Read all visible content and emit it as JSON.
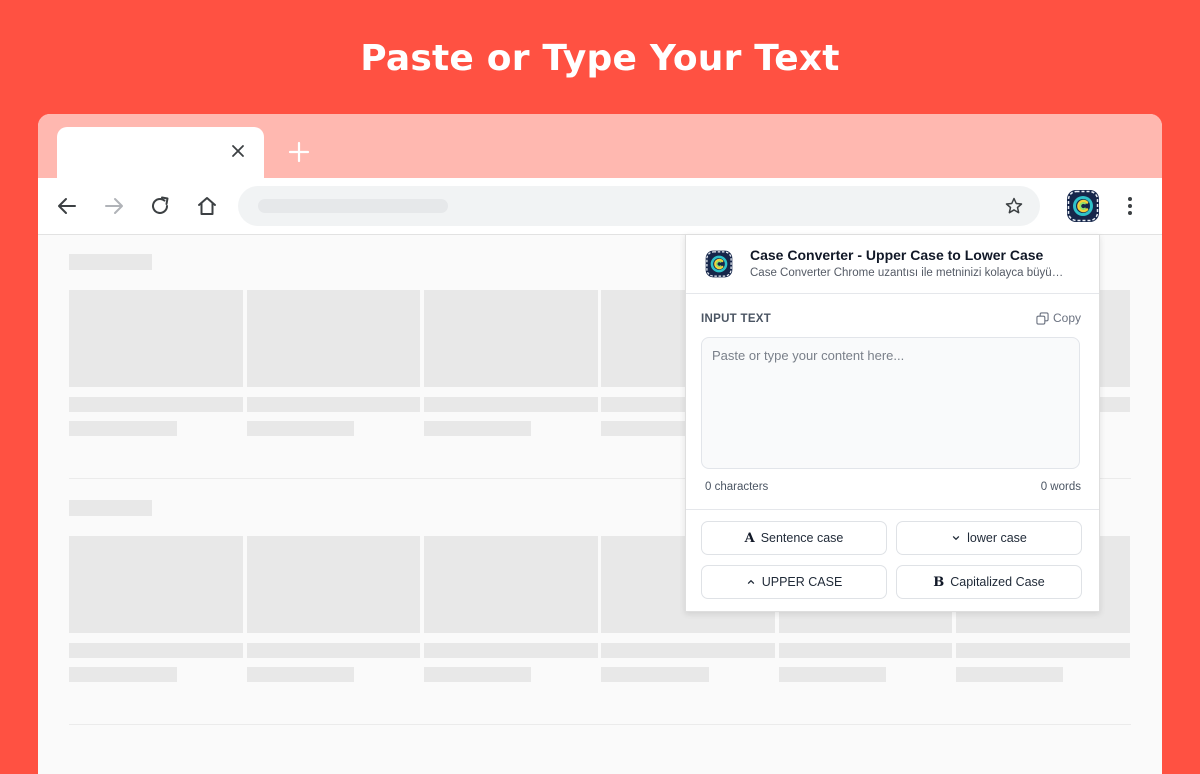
{
  "headline": "Paste or Type Your Text",
  "popup": {
    "title": "Case Converter - Upper Case to Lower Case",
    "subtitle": "Case Converter Chrome uzantısı ile metninizi kolayca büyü…",
    "input_label": "INPUT TEXT",
    "copy_label": "Copy",
    "textarea_placeholder": "Paste or type your content here...",
    "textarea_value": "",
    "char_count": "0 characters",
    "word_count": "0 words",
    "buttons": [
      {
        "label": "Sentence case",
        "icon": "A"
      },
      {
        "label": "lower case",
        "icon": "chevron-down-icon"
      },
      {
        "label": "UPPER CASE",
        "icon": "chevron-up-icon"
      },
      {
        "label": "Capitalized Case",
        "icon": "B"
      }
    ]
  },
  "colors": {
    "background": "#ff5142",
    "tabstrip": "#ffb8b0",
    "accent_text": "#ffffff"
  }
}
